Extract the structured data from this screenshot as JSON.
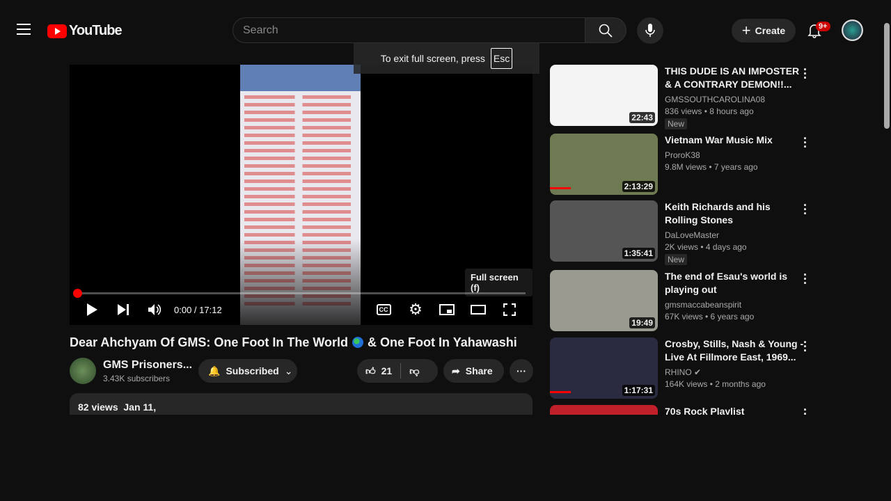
{
  "header": {
    "logo": "YouTube",
    "search_placeholder": "Search",
    "create_label": "Create",
    "notification_count": "9+"
  },
  "fullscreen_notice": {
    "text": "To exit full screen, press",
    "key": "Esc"
  },
  "player": {
    "time": "0:00 / 17:12",
    "progress_percent": 0,
    "tooltip": "Full screen (f)"
  },
  "video": {
    "title_part1": "Dear Ahchyam Of GMS: One Foot In The World",
    "title_part2": "& One Foot In Yahawashi",
    "channel": "GMS Prisoners...",
    "subscribers": "3.43K subscribers",
    "subscribed_label": "Subscribed",
    "likes": "21",
    "share_label": "Share",
    "views": "82 views",
    "date": "Jan 11,"
  },
  "recommendations": [
    {
      "title": "THIS DUDE IS AN IMPOSTER & A CONTRARY DEMON!!...",
      "channel": "GMSSOUTHCAROLINA08",
      "meta": "836 views  • 8 hours ago",
      "badge": "New",
      "duration": "22:43",
      "thumb_color": "#f4f4f4"
    },
    {
      "title": "Vietnam War Music Mix",
      "channel": "ProroK38",
      "meta": "9.8M views  • 7 years ago",
      "duration": "2:13:29",
      "thumb_color": "#6e7a52",
      "watched": true
    },
    {
      "title": "Keith Richards and his Rolling Stones",
      "channel": "DaLoveMaster",
      "meta": "2K views  • 4 days ago",
      "badge": "New",
      "duration": "1:35:41",
      "thumb_color": "#555555"
    },
    {
      "title": "The end of Esau's world is playing out",
      "channel": "gmsmaccabeanspirit",
      "meta": "67K views  • 6 years ago",
      "duration": "19:49",
      "thumb_color": "#9a9a90"
    },
    {
      "title": "Crosby, Stills, Nash & Young - Live At Fillmore East, 1969...",
      "channel": "RHINO",
      "meta": "164K views  • 2 months ago",
      "duration": "1:17:31",
      "thumb_color": "#2a2a40",
      "verified": true,
      "watched": true
    },
    {
      "title": "70s Rock Playlist",
      "thumb_color": "#c0202a"
    }
  ]
}
